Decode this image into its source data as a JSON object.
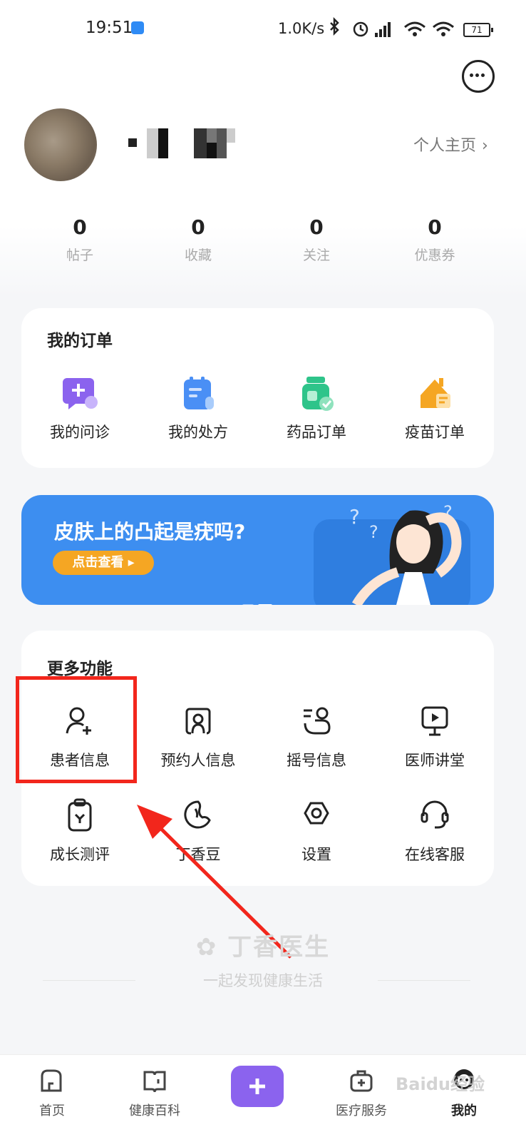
{
  "status_bar": {
    "time": "19:51",
    "speed": "1.0K/s",
    "battery": "71"
  },
  "profile": {
    "homepage_label": "个人主页"
  },
  "stats": [
    {
      "value": "0",
      "label": "帖子"
    },
    {
      "value": "0",
      "label": "收藏"
    },
    {
      "value": "0",
      "label": "关注"
    },
    {
      "value": "0",
      "label": "优惠券"
    }
  ],
  "orders": {
    "title": "我的订单",
    "items": [
      {
        "label": "我的问诊",
        "icon": "consult-icon",
        "color": "#8b63ee"
      },
      {
        "label": "我的处方",
        "icon": "prescription-icon",
        "color": "#4a8ff5"
      },
      {
        "label": "药品订单",
        "icon": "medicine-icon",
        "color": "#2ec48a"
      },
      {
        "label": "疫苗订单",
        "icon": "vaccine-icon",
        "color": "#f5a623"
      }
    ]
  },
  "banner": {
    "title": "皮肤上的凸起是疣吗?",
    "button": "点击查看 ▸"
  },
  "more": {
    "title": "更多功能",
    "items": [
      {
        "label": "患者信息",
        "icon": "add-user-icon"
      },
      {
        "label": "预约人信息",
        "icon": "appointment-person-icon"
      },
      {
        "label": "摇号信息",
        "icon": "lottery-icon"
      },
      {
        "label": "医师讲堂",
        "icon": "video-lecture-icon"
      },
      {
        "label": "成长测评",
        "icon": "clipboard-icon"
      },
      {
        "label": "丁香豆",
        "icon": "bean-icon"
      },
      {
        "label": "设置",
        "icon": "settings-icon"
      },
      {
        "label": "在线客服",
        "icon": "headset-icon"
      }
    ]
  },
  "footer": {
    "brand": "丁香医生",
    "slogan": "一起发现健康生活"
  },
  "tabbar": [
    {
      "label": "首页",
      "icon": "home-icon"
    },
    {
      "label": "健康百科",
      "icon": "book-icon"
    },
    {
      "label": "",
      "icon": "plus-icon"
    },
    {
      "label": "医疗服务",
      "icon": "medical-service-icon"
    },
    {
      "label": "我的",
      "icon": "profile-icon"
    }
  ],
  "watermark": "Baidu经验",
  "colors": {
    "accent": "#8b63ee",
    "banner": "#3d8ef0",
    "highlight": "#f2261c"
  }
}
